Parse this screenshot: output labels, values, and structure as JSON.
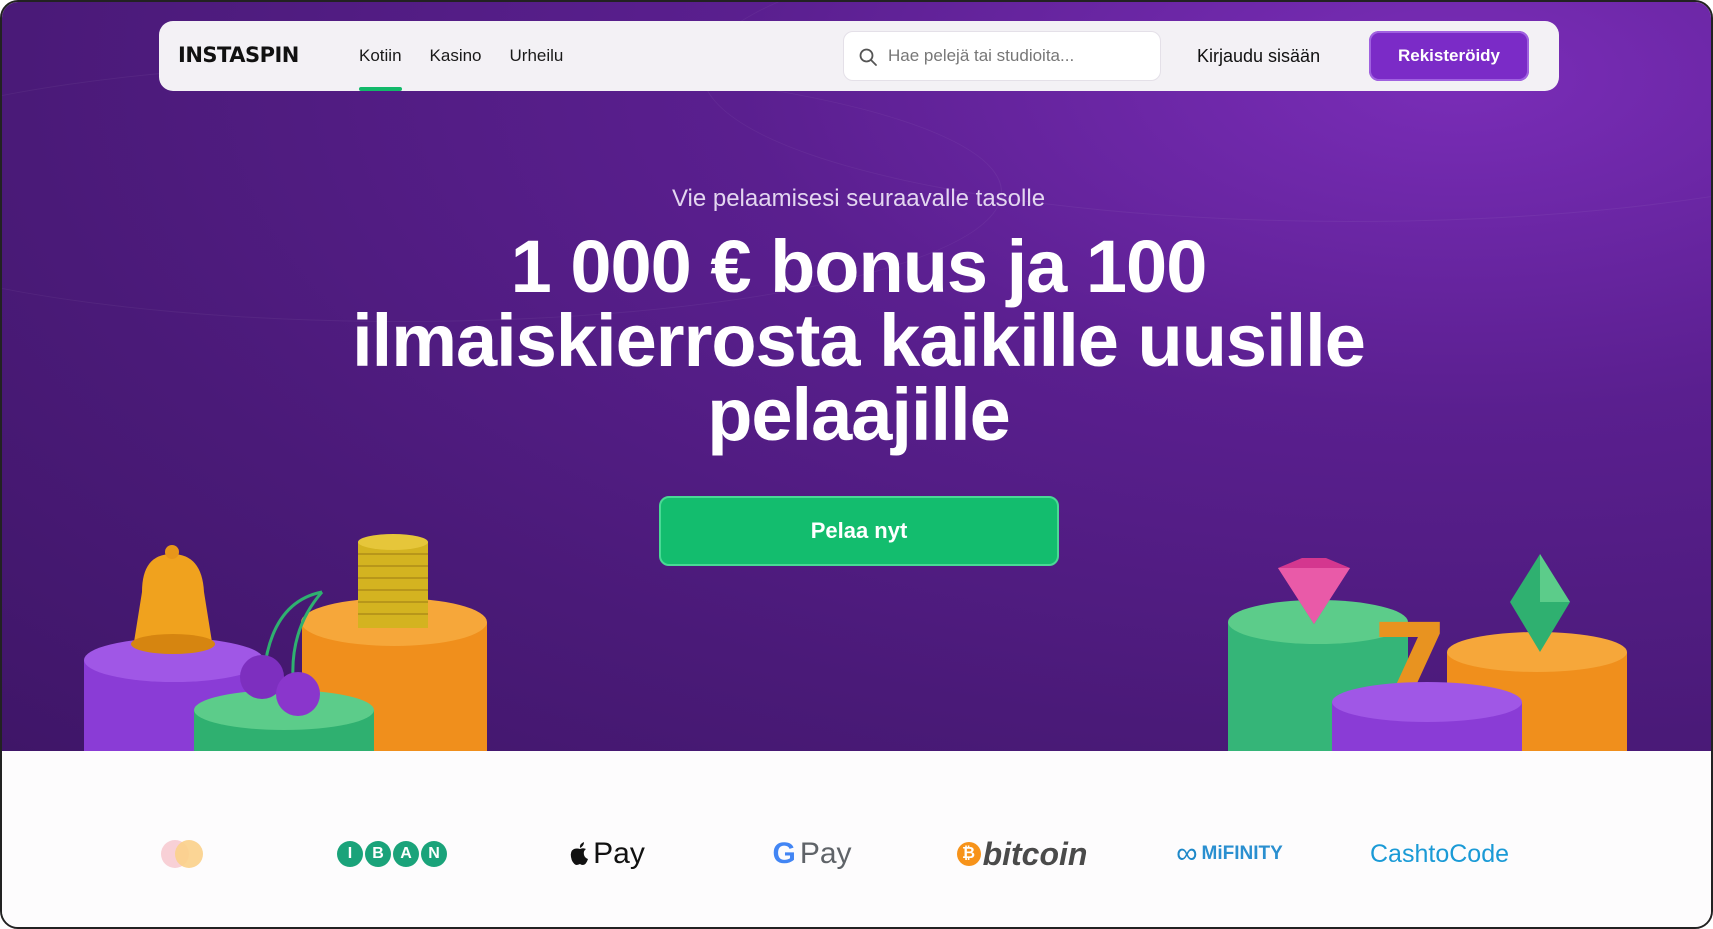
{
  "header": {
    "logo_text": "INSTASPIN",
    "nav": [
      {
        "label": "Kotiin",
        "active": true
      },
      {
        "label": "Kasino",
        "active": false
      },
      {
        "label": "Urheilu",
        "active": false
      }
    ],
    "search_placeholder": "Hae pelejä tai studioita...",
    "login_label": "Kirjaudu sisään",
    "register_label": "Rekisteröidy"
  },
  "hero": {
    "subtitle": "Vie pelaamisesi seuraavalle tasolle",
    "headline": "1 000 € bonus ja 100 ilmaiskierrosta kaikille uusille pelaajille",
    "cta_label": "Pelaa nyt"
  },
  "payments": {
    "iban_letters": [
      "I",
      "B",
      "A",
      "N"
    ],
    "apple_pay": "Pay",
    "google_pay": "Pay",
    "bitcoin": "bitcoin",
    "mifinity": "MiFINITY",
    "cashtocode_cash": "Cash",
    "cashtocode_to": "to",
    "cashtocode_code": "Code"
  },
  "colors": {
    "hero_bg": "#4a1a78",
    "brand_purple": "#7b2bc7",
    "cta_green": "#13bd6e",
    "nav_bg": "#f3f1f5"
  }
}
